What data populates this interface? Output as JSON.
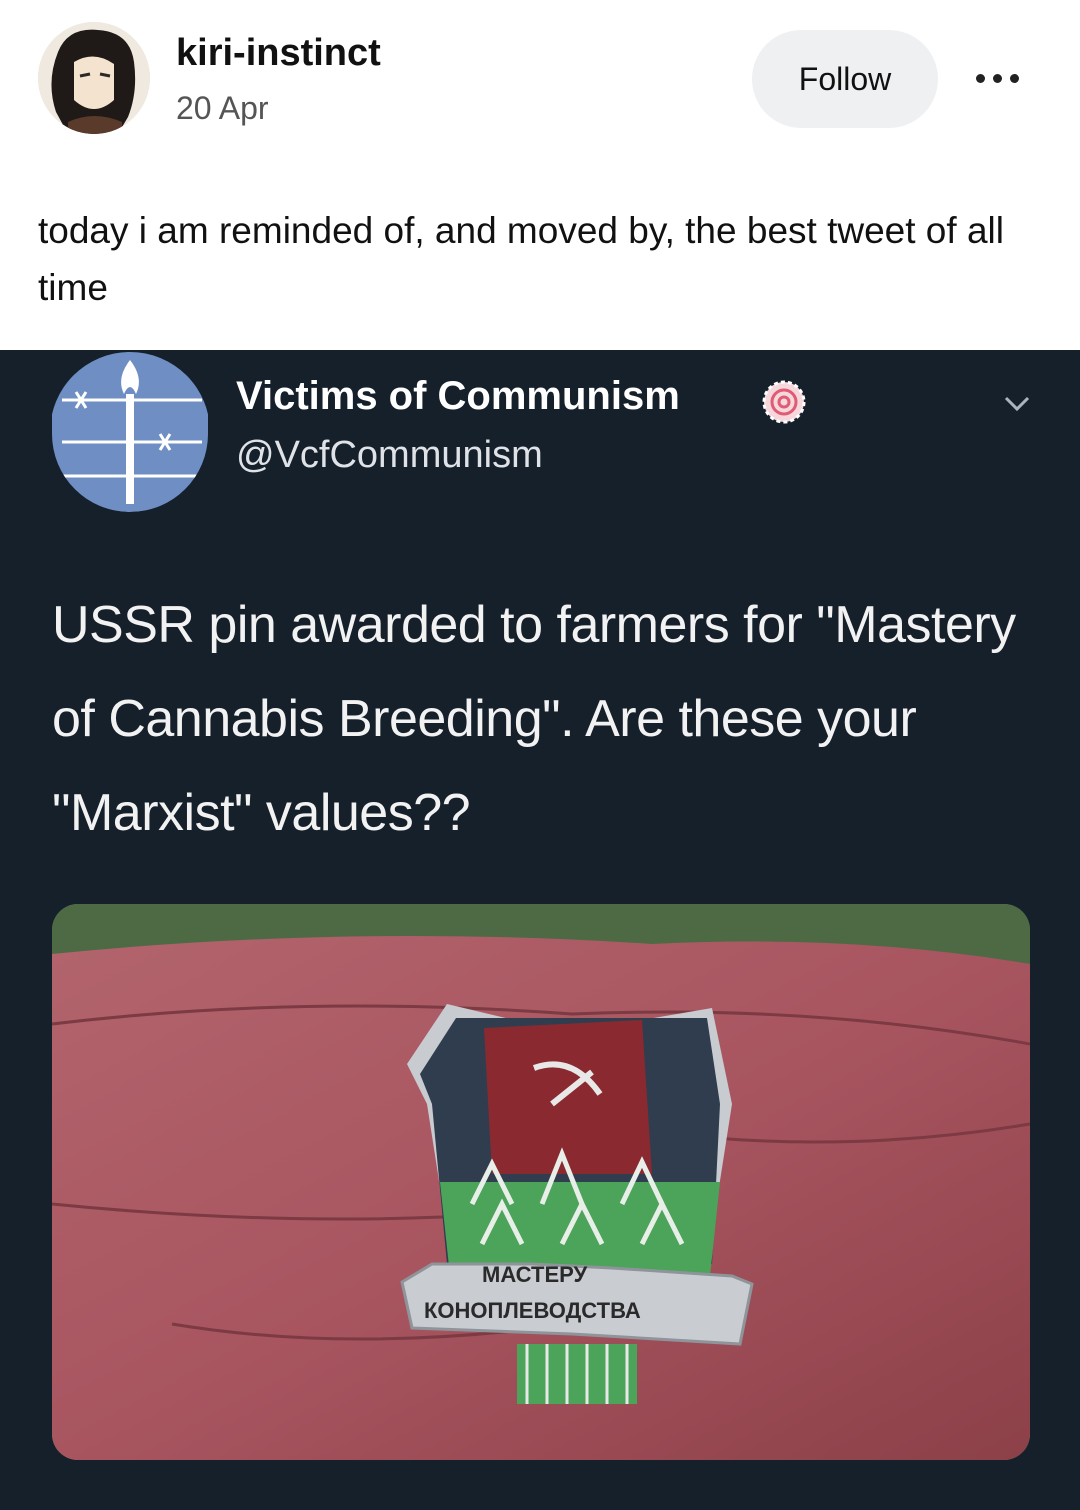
{
  "post": {
    "username": "kiri-instinct",
    "date": "20 Apr",
    "follow_label": "Follow",
    "more_icon": "ellipsis-icon",
    "caption": "today i am reminded of, and moved by, the best tweet of all time"
  },
  "tweet": {
    "display_name": "Victims of Communism",
    "handle": "@VcfCommunism",
    "verified_icon": "verified-badge-icon",
    "menu_icon": "chevron-down-icon",
    "text": "USSR pin awarded to farmers for \"Mastery of Cannabis Breeding\". Are these your \"Marxist\" values??",
    "image": {
      "pin_text_line1": "МАСТЕРУ",
      "pin_text_line2": "КОНОПЛЕВОДСТВА"
    }
  },
  "colors": {
    "tweet_background": "#15202b",
    "follow_button_bg": "#eef0f2",
    "pin_red": "#8a2a30",
    "pin_green": "#4ca35a"
  }
}
